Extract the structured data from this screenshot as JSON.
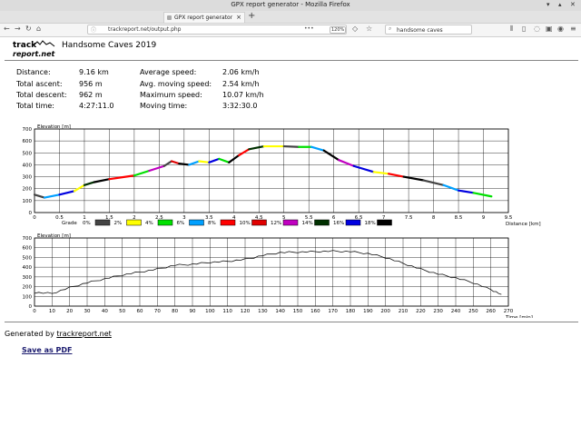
{
  "window": {
    "title": "GPX report generator - Mozilla Firefox",
    "tab_label": "GPX report generator"
  },
  "navbar": {
    "url": "trackreport.net/output.php",
    "zoom": "120%",
    "search_value": "handsome caves"
  },
  "page": {
    "logo_line1": "track",
    "logo_line2": "report.net",
    "title": "Handsome Caves 2019",
    "stats_left": [
      {
        "label": "Distance:",
        "value": "9.16 km"
      },
      {
        "label": "Total ascent:",
        "value": "956 m"
      },
      {
        "label": "Total descent:",
        "value": "962 m"
      },
      {
        "label": "Total time:",
        "value": "4:27:11.0"
      }
    ],
    "stats_right": [
      {
        "label": "Average speed:",
        "value": "2.06 km/h"
      },
      {
        "label": "Avg. moving speed:",
        "value": "2.54 km/h"
      },
      {
        "label": "Maximum speed:",
        "value": "10.07 km/h"
      },
      {
        "label": "Moving time:",
        "value": "3:32:30.0"
      }
    ],
    "generated_prefix": "Generated by ",
    "generated_link": "trackreport.net",
    "save_pdf": "Save as PDF"
  },
  "colors": {
    "link": "#1a1a6e"
  },
  "chart_data": [
    {
      "type": "line",
      "ylabel": "Elevation [m]",
      "xlabel": "Distance [km]",
      "xlim": [
        0,
        9.5
      ],
      "ylim": [
        0,
        700
      ],
      "x_ticks": [
        "0",
        "0.5",
        "1",
        "1.5",
        "2",
        "2.5",
        "3",
        "3.5",
        "4",
        "4.5",
        "5",
        "5.5",
        "6",
        "6.5",
        "7",
        "7.5",
        "8",
        "8.5",
        "9",
        "9.5"
      ],
      "y_ticks": [
        "0",
        "100",
        "200",
        "300",
        "400",
        "500",
        "600",
        "700"
      ],
      "grid": true,
      "x": [
        0,
        0.2,
        0.5,
        0.8,
        1.0,
        1.2,
        1.5,
        2.0,
        2.3,
        2.6,
        2.75,
        2.9,
        3.1,
        3.3,
        3.5,
        3.7,
        3.9,
        4.1,
        4.3,
        4.6,
        5.0,
        5.3,
        5.55,
        5.8,
        6.1,
        6.4,
        6.8,
        7.1,
        7.4,
        7.8,
        8.2,
        8.5,
        8.8,
        9.16
      ],
      "y": [
        150,
        125,
        150,
        180,
        230,
        255,
        280,
        310,
        350,
        390,
        430,
        410,
        400,
        430,
        420,
        450,
        420,
        480,
        530,
        555,
        555,
        550,
        550,
        520,
        440,
        390,
        340,
        325,
        300,
        270,
        230,
        185,
        165,
        135
      ],
      "legend_title": "Grade",
      "legend": [
        {
          "label": "0%",
          "color": "#444444"
        },
        {
          "label": "2%",
          "color": "#ffff00"
        },
        {
          "label": "4%",
          "color": "#00e000"
        },
        {
          "label": "6%",
          "color": "#00a0ff"
        },
        {
          "label": "8%",
          "color": "#ff0000"
        },
        {
          "label": "10%",
          "color": "#e00000"
        },
        {
          "label": "12%",
          "color": "#c000c0"
        },
        {
          "label": "14%",
          "color": "#003000"
        },
        {
          "label": "16%",
          "color": "#0000e0"
        },
        {
          "label": "18%",
          "color": "#000000"
        }
      ]
    },
    {
      "type": "line",
      "ylabel": "Elevation [m]",
      "xlabel": "Time [min]",
      "xlim": [
        0,
        270
      ],
      "ylim": [
        0,
        700
      ],
      "x_ticks": [
        "0",
        "10",
        "20",
        "30",
        "40",
        "50",
        "60",
        "70",
        "80",
        "90",
        "100",
        "110",
        "120",
        "130",
        "140",
        "150",
        "160",
        "170",
        "180",
        "190",
        "200",
        "210",
        "220",
        "230",
        "240",
        "250",
        "260",
        "270"
      ],
      "y_ticks": [
        "0",
        "100",
        "200",
        "300",
        "400",
        "500",
        "600",
        "700"
      ],
      "grid": true,
      "x": [
        0,
        10,
        20,
        30,
        40,
        50,
        60,
        70,
        80,
        90,
        100,
        110,
        120,
        130,
        140,
        150,
        160,
        170,
        180,
        190,
        200,
        210,
        220,
        230,
        240,
        250,
        260,
        266
      ],
      "y": [
        140,
        130,
        190,
        240,
        280,
        320,
        350,
        380,
        420,
        430,
        450,
        460,
        480,
        520,
        550,
        555,
        560,
        565,
        560,
        540,
        500,
        440,
        380,
        330,
        290,
        240,
        170,
        120
      ]
    }
  ]
}
